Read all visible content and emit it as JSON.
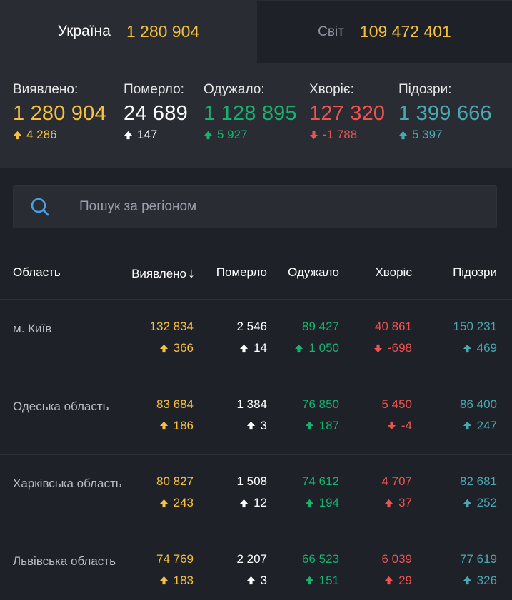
{
  "tabs": [
    {
      "name": "Україна",
      "value": "1 280 904"
    },
    {
      "name": "Світ",
      "value": "109 472 401"
    }
  ],
  "summary": [
    {
      "label": "Виявлено:",
      "value": "1 280 904",
      "delta": "4 286",
      "dir": "up",
      "color": "#f6c143"
    },
    {
      "label": "Померло:",
      "value": "24 689",
      "delta": "147",
      "dir": "up",
      "color": "#ffffff"
    },
    {
      "label": "Одужало:",
      "value": "1 128 895",
      "delta": "5 927",
      "dir": "up",
      "color": "#17b26e"
    },
    {
      "label": "Хворіє:",
      "value": "127 320",
      "delta": "-1 788",
      "dir": "down",
      "color": "#ef5350"
    },
    {
      "label": "Підозри:",
      "value": "1 399 666",
      "delta": "5 397",
      "dir": "up",
      "color": "#49a9b3"
    }
  ],
  "search": {
    "placeholder": "Пошук за регіоном"
  },
  "table": {
    "headers": [
      "Область",
      "Виявлено",
      "Померло",
      "Одужало",
      "Хворіє",
      "Підозри"
    ],
    "sort_indicator": "↓",
    "rows": [
      {
        "name": "м. Київ",
        "cells": [
          {
            "v": "132 834",
            "d": "366",
            "dir": "up"
          },
          {
            "v": "2 546",
            "d": "14",
            "dir": "up"
          },
          {
            "v": "89 427",
            "d": "1 050",
            "dir": "up"
          },
          {
            "v": "40 861",
            "d": "-698",
            "dir": "down"
          },
          {
            "v": "150 231",
            "d": "469",
            "dir": "up"
          }
        ]
      },
      {
        "name": "Одеська область",
        "cells": [
          {
            "v": "83 684",
            "d": "186",
            "dir": "up"
          },
          {
            "v": "1 384",
            "d": "3",
            "dir": "up"
          },
          {
            "v": "76 850",
            "d": "187",
            "dir": "up"
          },
          {
            "v": "5 450",
            "d": "-4",
            "dir": "down"
          },
          {
            "v": "86 400",
            "d": "247",
            "dir": "up"
          }
        ]
      },
      {
        "name": "Харківська область",
        "cells": [
          {
            "v": "80 827",
            "d": "243",
            "dir": "up"
          },
          {
            "v": "1 508",
            "d": "12",
            "dir": "up"
          },
          {
            "v": "74 612",
            "d": "194",
            "dir": "up"
          },
          {
            "v": "4 707",
            "d": "37",
            "dir": "up"
          },
          {
            "v": "82 681",
            "d": "252",
            "dir": "up"
          }
        ]
      },
      {
        "name": "Львівська область",
        "cells": [
          {
            "v": "74 769",
            "d": "183",
            "dir": "up"
          },
          {
            "v": "2 207",
            "d": "3",
            "dir": "up"
          },
          {
            "v": "66 523",
            "d": "151",
            "dir": "up"
          },
          {
            "v": "6 039",
            "d": "29",
            "dir": "up"
          },
          {
            "v": "77 619",
            "d": "326",
            "dir": "up"
          }
        ]
      }
    ]
  },
  "colors": {
    "background": "#1f2128",
    "panel": "#2a2c33",
    "confirmed": "#f6c143",
    "deaths": "#ffffff",
    "recovered": "#17b26e",
    "active": "#ef5350",
    "suspected": "#49a9b3",
    "search_icon": "#4a9fe0"
  }
}
